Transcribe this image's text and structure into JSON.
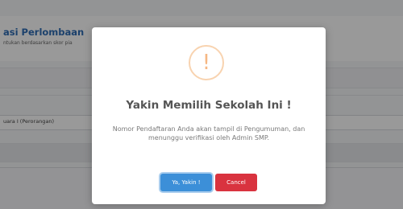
{
  "page": {
    "title": "asi Perlombaan",
    "subtitle": "ntukan berdasarkan skor pia",
    "field_value": "uara I (Perorangan)"
  },
  "modal": {
    "icon": "warning-icon",
    "icon_glyph": "!",
    "title": "Yakin Memilih Sekolah Ini !",
    "message": "Nomor Pendaftaran Anda akan tampil di Pengumuman, dan menunggu verifikasi oleh Admin SMP.",
    "confirm_label": "Ya, Yakin !",
    "cancel_label": "Cancel"
  },
  "colors": {
    "accent": "#3c8fd8",
    "danger": "#d9333f",
    "warning": "#f6b783",
    "title_blue": "#2f6db5"
  }
}
